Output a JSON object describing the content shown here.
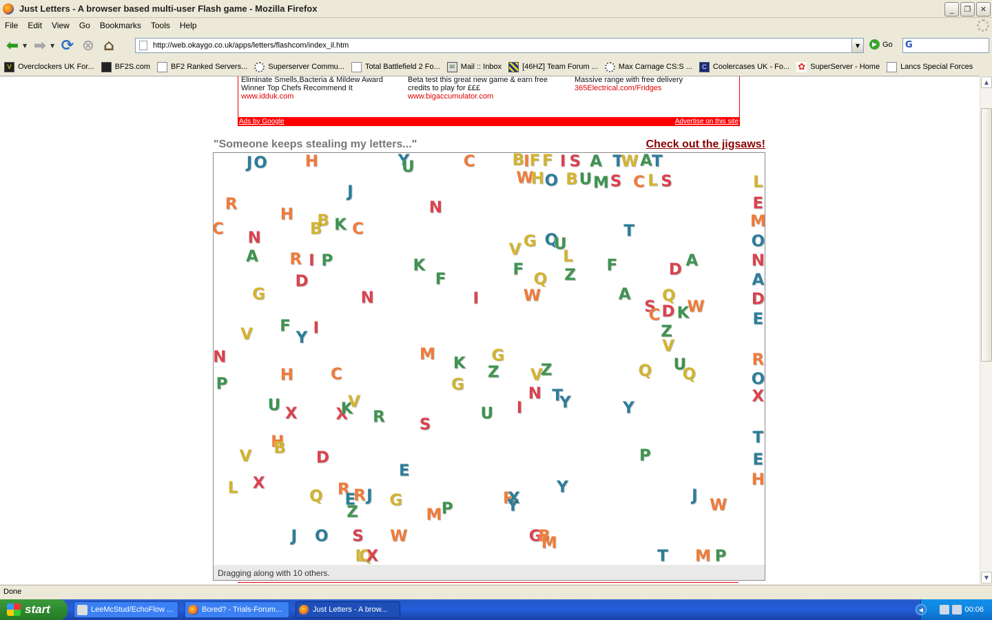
{
  "window": {
    "title": "Just Letters - A browser based multi-user Flash game - Mozilla Firefox",
    "minimize": "_",
    "maximize": "❐",
    "close": "✕"
  },
  "menu": [
    "File",
    "Edit",
    "View",
    "Go",
    "Bookmarks",
    "Tools",
    "Help"
  ],
  "nav": {
    "url": "http://web.okaygo.co.uk/apps/letters/flashcom/index_il.htm",
    "go_label": "Go"
  },
  "bookmarks": [
    {
      "label": "Overclockers UK For...",
      "icon": "oc-icon"
    },
    {
      "label": "BF2S.com",
      "icon": "bf2s-icon"
    },
    {
      "label": "BF2 Ranked Servers...",
      "icon": "bf2-icon"
    },
    {
      "label": "Superserver Commu...",
      "icon": "gear-icon"
    },
    {
      "label": "Total Battlefield 2 Fo...",
      "icon": "tbf-icon"
    },
    {
      "label": "Mail :: Inbox",
      "icon": "mail-icon"
    },
    {
      "label": "[46HZ] Team Forum ...",
      "icon": "checker-icon"
    },
    {
      "label": "Max Carnage CS:S ...",
      "icon": "gear-icon"
    },
    {
      "label": "Coolercases UK - Fo...",
      "icon": "cc-icon"
    },
    {
      "label": "SuperServer - Home",
      "icon": "flower-icon"
    },
    {
      "label": "Lancs Special Forces",
      "icon": "page-icon"
    }
  ],
  "ads": [
    {
      "line1": "Eliminate Smells,Bacteria & Mildew Award",
      "line2": "Winner Top Chefs Recommend It",
      "url": "www.idduk.com"
    },
    {
      "line1": "Beta test this great new game & earn free",
      "line2": "credits to play for £££",
      "url": "www.bigaccumulator.com"
    },
    {
      "line1": "Massive range with free delivery",
      "line2": "",
      "url": "365Electrical.com/Fridges"
    }
  ],
  "ad_footer": {
    "left": "Ads by Google",
    "right": "Advertise on this site"
  },
  "tagline": "\"Someone keeps stealing my letters...\"",
  "jigsaw_link": "Check out the jigsaws!",
  "game": {
    "status": "Dragging along with 10 others.",
    "colors": {
      "red": "#d9434f",
      "green": "#3f9350",
      "blue": "#2c7d9a",
      "yellow": "#d3b431",
      "orange": "#ef7b3a"
    },
    "letters": [
      {
        "ch": "J",
        "c": "blue",
        "x": 6.5,
        "y": 2.5
      },
      {
        "ch": "O",
        "c": "blue",
        "x": 8.5,
        "y": 2.5
      },
      {
        "ch": "H",
        "c": "orange",
        "x": 17.8,
        "y": 2.2
      },
      {
        "ch": "Y",
        "c": "blue",
        "x": 34.5,
        "y": 2
      },
      {
        "ch": "U",
        "c": "green",
        "x": 35.3,
        "y": 3.5
      },
      {
        "ch": "C",
        "c": "orange",
        "x": 46.4,
        "y": 2.2
      },
      {
        "ch": "B",
        "c": "yellow",
        "x": 55.3,
        "y": 1.8
      },
      {
        "ch": "I",
        "c": "orange",
        "x": 56.8,
        "y": 2.2
      },
      {
        "ch": "F",
        "c": "yellow",
        "x": 58.3,
        "y": 2
      },
      {
        "ch": "F",
        "c": "yellow",
        "x": 60.6,
        "y": 2
      },
      {
        "ch": "I",
        "c": "red",
        "x": 63.4,
        "y": 2.2
      },
      {
        "ch": "S",
        "c": "red",
        "x": 65.6,
        "y": 2.2
      },
      {
        "ch": "A",
        "c": "green",
        "x": 69.4,
        "y": 2.2
      },
      {
        "ch": "T",
        "c": "blue",
        "x": 73.4,
        "y": 2.2
      },
      {
        "ch": "W",
        "c": "yellow",
        "x": 75.5,
        "y": 2.2
      },
      {
        "ch": "A",
        "c": "green",
        "x": 78.5,
        "y": 2
      },
      {
        "ch": "T",
        "c": "blue",
        "x": 80.5,
        "y": 2.2
      },
      {
        "ch": "W",
        "c": "orange",
        "x": 56.5,
        "y": 6.2
      },
      {
        "ch": "H",
        "c": "yellow",
        "x": 58.8,
        "y": 6.3
      },
      {
        "ch": "O",
        "c": "blue",
        "x": 61.3,
        "y": 6.8
      },
      {
        "ch": "B",
        "c": "yellow",
        "x": 65.0,
        "y": 6.6
      },
      {
        "ch": "U",
        "c": "green",
        "x": 67.5,
        "y": 6.6
      },
      {
        "ch": "M",
        "c": "green",
        "x": 70.3,
        "y": 7.3
      },
      {
        "ch": "S",
        "c": "red",
        "x": 73.0,
        "y": 7.0
      },
      {
        "ch": "C",
        "c": "orange",
        "x": 77.2,
        "y": 7.2
      },
      {
        "ch": "L",
        "c": "yellow",
        "x": 79.7,
        "y": 6.8
      },
      {
        "ch": "S",
        "c": "red",
        "x": 82.2,
        "y": 7.0
      },
      {
        "ch": "L",
        "c": "yellow",
        "x": 98.8,
        "y": 7.2
      },
      {
        "ch": "E",
        "c": "red",
        "x": 98.8,
        "y": 12.3
      },
      {
        "ch": "M",
        "c": "orange",
        "x": 98.8,
        "y": 16.8
      },
      {
        "ch": "O",
        "c": "blue",
        "x": 98.8,
        "y": 21.5
      },
      {
        "ch": "N",
        "c": "red",
        "x": 98.8,
        "y": 26.2
      },
      {
        "ch": "A",
        "c": "blue",
        "x": 98.8,
        "y": 31.0
      },
      {
        "ch": "D",
        "c": "red",
        "x": 98.8,
        "y": 35.7
      },
      {
        "ch": "E",
        "c": "blue",
        "x": 98.8,
        "y": 40.5
      },
      {
        "ch": "R",
        "c": "orange",
        "x": 98.8,
        "y": 50.3
      },
      {
        "ch": "O",
        "c": "blue",
        "x": 98.8,
        "y": 55.0
      },
      {
        "ch": "X",
        "c": "red",
        "x": 98.8,
        "y": 59.2
      },
      {
        "ch": "T",
        "c": "blue",
        "x": 98.8,
        "y": 69.2
      },
      {
        "ch": "E",
        "c": "blue",
        "x": 98.8,
        "y": 74.5
      },
      {
        "ch": "H",
        "c": "orange",
        "x": 98.8,
        "y": 79.5
      },
      {
        "ch": "J",
        "c": "blue",
        "x": 24.8,
        "y": 9.5
      },
      {
        "ch": "R",
        "c": "orange",
        "x": 3.2,
        "y": 12.5
      },
      {
        "ch": "N",
        "c": "red",
        "x": 40.3,
        "y": 13.3
      },
      {
        "ch": "H",
        "c": "orange",
        "x": 13.3,
        "y": 15
      },
      {
        "ch": "B",
        "c": "yellow",
        "x": 19.9,
        "y": 16.5
      },
      {
        "ch": "B",
        "c": "yellow",
        "x": 18.6,
        "y": 18.5
      },
      {
        "ch": "K",
        "c": "green",
        "x": 23.0,
        "y": 17.5
      },
      {
        "ch": "C",
        "c": "orange",
        "x": 26.2,
        "y": 18.6
      },
      {
        "ch": "C",
        "c": "orange",
        "x": 0.8,
        "y": 18.6
      },
      {
        "ch": "N",
        "c": "red",
        "x": 7.4,
        "y": 20.8
      },
      {
        "ch": "A",
        "c": "green",
        "x": 7.0,
        "y": 25.2
      },
      {
        "ch": "R",
        "c": "orange",
        "x": 14.9,
        "y": 26.0
      },
      {
        "ch": "I",
        "c": "red",
        "x": 17.8,
        "y": 26.3
      },
      {
        "ch": "P",
        "c": "green",
        "x": 20.6,
        "y": 26.3
      },
      {
        "ch": "D",
        "c": "red",
        "x": 16.0,
        "y": 31.3
      },
      {
        "ch": "K",
        "c": "green",
        "x": 37.3,
        "y": 27.5
      },
      {
        "ch": "F",
        "c": "green",
        "x": 41.2,
        "y": 30.8
      },
      {
        "ch": "I",
        "c": "red",
        "x": 47.6,
        "y": 35.5
      },
      {
        "ch": "N",
        "c": "red",
        "x": 27.9,
        "y": 35.3
      },
      {
        "ch": "G",
        "c": "yellow",
        "x": 8.2,
        "y": 34.5
      },
      {
        "ch": "V",
        "c": "yellow",
        "x": 54.7,
        "y": 23.5
      },
      {
        "ch": "G",
        "c": "yellow",
        "x": 57.4,
        "y": 21.5
      },
      {
        "ch": "Q",
        "c": "blue",
        "x": 61.3,
        "y": 21.2
      },
      {
        "ch": "U",
        "c": "green",
        "x": 62.9,
        "y": 22.3
      },
      {
        "ch": "L",
        "c": "yellow",
        "x": 64.3,
        "y": 25.3
      },
      {
        "ch": "F",
        "c": "green",
        "x": 55.3,
        "y": 28.5
      },
      {
        "ch": "Q",
        "c": "yellow",
        "x": 59.3,
        "y": 30.8
      },
      {
        "ch": "W",
        "c": "orange",
        "x": 57.8,
        "y": 34.7
      },
      {
        "ch": "Z",
        "c": "green",
        "x": 64.7,
        "y": 29.8
      },
      {
        "ch": "T",
        "c": "blue",
        "x": 75.4,
        "y": 19.0
      },
      {
        "ch": "F",
        "c": "green",
        "x": 72.3,
        "y": 27.5
      },
      {
        "ch": "A",
        "c": "green",
        "x": 74.6,
        "y": 34.5
      },
      {
        "ch": "D",
        "c": "red",
        "x": 83.8,
        "y": 28.5
      },
      {
        "ch": "A",
        "c": "green",
        "x": 86.8,
        "y": 26.3
      },
      {
        "ch": "Q",
        "c": "yellow",
        "x": 82.6,
        "y": 34.8
      },
      {
        "ch": "S",
        "c": "red",
        "x": 79.2,
        "y": 37.5
      },
      {
        "ch": "C",
        "c": "orange",
        "x": 80.0,
        "y": 39.5
      },
      {
        "ch": "D",
        "c": "red",
        "x": 82.5,
        "y": 38.7
      },
      {
        "ch": "K",
        "c": "green",
        "x": 85.2,
        "y": 38.9
      },
      {
        "ch": "W",
        "c": "orange",
        "x": 87.5,
        "y": 37.5
      },
      {
        "ch": "Z",
        "c": "green",
        "x": 82.2,
        "y": 43.5
      },
      {
        "ch": "V",
        "c": "yellow",
        "x": 82.5,
        "y": 47.0
      },
      {
        "ch": "U",
        "c": "green",
        "x": 84.6,
        "y": 51.5
      },
      {
        "ch": "Q",
        "c": "yellow",
        "x": 86.3,
        "y": 53.8
      },
      {
        "ch": "Q",
        "c": "yellow",
        "x": 78.3,
        "y": 53.0
      },
      {
        "ch": "V",
        "c": "yellow",
        "x": 6.0,
        "y": 44.1
      },
      {
        "ch": "F",
        "c": "green",
        "x": 13.0,
        "y": 42.2
      },
      {
        "ch": "Y",
        "c": "blue",
        "x": 16.0,
        "y": 45.0
      },
      {
        "ch": "I",
        "c": "red",
        "x": 18.6,
        "y": 42.7
      },
      {
        "ch": "N",
        "c": "red",
        "x": 1.1,
        "y": 49.7
      },
      {
        "ch": "P",
        "c": "green",
        "x": 1.5,
        "y": 56.2
      },
      {
        "ch": "H",
        "c": "orange",
        "x": 13.3,
        "y": 54.0
      },
      {
        "ch": "C",
        "c": "orange",
        "x": 22.3,
        "y": 53.8
      },
      {
        "ch": "M",
        "c": "orange",
        "x": 38.8,
        "y": 49.0
      },
      {
        "ch": "K",
        "c": "green",
        "x": 44.6,
        "y": 51.2
      },
      {
        "ch": "G",
        "c": "yellow",
        "x": 51.6,
        "y": 49.3
      },
      {
        "ch": "Z",
        "c": "green",
        "x": 50.8,
        "y": 53.3
      },
      {
        "ch": "G",
        "c": "yellow",
        "x": 44.3,
        "y": 56.3
      },
      {
        "ch": "V",
        "c": "yellow",
        "x": 58.6,
        "y": 54.0
      },
      {
        "ch": "Z",
        "c": "green",
        "x": 60.4,
        "y": 52.8
      },
      {
        "ch": "N",
        "c": "red",
        "x": 58.3,
        "y": 58.5
      },
      {
        "ch": "T",
        "c": "blue",
        "x": 62.4,
        "y": 59.0
      },
      {
        "ch": "Y",
        "c": "blue",
        "x": 63.8,
        "y": 60.7
      },
      {
        "ch": "I",
        "c": "red",
        "x": 55.5,
        "y": 62.0
      },
      {
        "ch": "Y",
        "c": "blue",
        "x": 75.3,
        "y": 62.0
      },
      {
        "ch": "U",
        "c": "green",
        "x": 11.0,
        "y": 61.3
      },
      {
        "ch": "X",
        "c": "red",
        "x": 14.1,
        "y": 63.3
      },
      {
        "ch": "X",
        "c": "red",
        "x": 23.3,
        "y": 63.5
      },
      {
        "ch": "K",
        "c": "green",
        "x": 24.2,
        "y": 62.2
      },
      {
        "ch": "V",
        "c": "yellow",
        "x": 25.5,
        "y": 60.5
      },
      {
        "ch": "R",
        "c": "green",
        "x": 30.0,
        "y": 64.2
      },
      {
        "ch": "S",
        "c": "red",
        "x": 38.4,
        "y": 66.1
      },
      {
        "ch": "U",
        "c": "green",
        "x": 49.6,
        "y": 63.4
      },
      {
        "ch": "H",
        "c": "orange",
        "x": 11.6,
        "y": 70.2
      },
      {
        "ch": "B",
        "c": "yellow",
        "x": 12.0,
        "y": 71.8
      },
      {
        "ch": "V",
        "c": "yellow",
        "x": 5.8,
        "y": 73.8
      },
      {
        "ch": "D",
        "c": "red",
        "x": 19.8,
        "y": 74.1
      },
      {
        "ch": "P",
        "c": "green",
        "x": 78.3,
        "y": 73.5
      },
      {
        "ch": "E",
        "c": "blue",
        "x": 34.6,
        "y": 77.3
      },
      {
        "ch": "L",
        "c": "yellow",
        "x": 3.5,
        "y": 81.5
      },
      {
        "ch": "X",
        "c": "red",
        "x": 8.2,
        "y": 80.2
      },
      {
        "ch": "Q",
        "c": "yellow",
        "x": 18.6,
        "y": 83.5
      },
      {
        "ch": "R",
        "c": "orange",
        "x": 23.6,
        "y": 81.8
      },
      {
        "ch": "R",
        "c": "orange",
        "x": 26.5,
        "y": 83.2
      },
      {
        "ch": "E",
        "c": "blue",
        "x": 24.8,
        "y": 84.2
      },
      {
        "ch": "J",
        "c": "blue",
        "x": 28.3,
        "y": 83.2
      },
      {
        "ch": "Z",
        "c": "green",
        "x": 25.2,
        "y": 87.3
      },
      {
        "ch": "G",
        "c": "yellow",
        "x": 33.1,
        "y": 84.5
      },
      {
        "ch": "M",
        "c": "orange",
        "x": 40.0,
        "y": 88.0
      },
      {
        "ch": "P",
        "c": "green",
        "x": 42.4,
        "y": 86.5
      },
      {
        "ch": "R",
        "c": "orange",
        "x": 53.6,
        "y": 84.0
      },
      {
        "ch": "X",
        "c": "blue",
        "x": 54.5,
        "y": 84.0
      },
      {
        "ch": "Y",
        "c": "blue",
        "x": 54.3,
        "y": 85.8
      },
      {
        "ch": "Y",
        "c": "blue",
        "x": 63.3,
        "y": 81.2
      },
      {
        "ch": "J",
        "c": "blue",
        "x": 87.3,
        "y": 83.3
      },
      {
        "ch": "W",
        "c": "orange",
        "x": 91.6,
        "y": 85.7
      },
      {
        "ch": "J",
        "c": "blue",
        "x": 14.6,
        "y": 93.1
      },
      {
        "ch": "O",
        "c": "blue",
        "x": 19.6,
        "y": 93.1
      },
      {
        "ch": "S",
        "c": "red",
        "x": 26.2,
        "y": 93.1
      },
      {
        "ch": "W",
        "c": "orange",
        "x": 33.6,
        "y": 93.1
      },
      {
        "ch": "G",
        "c": "red",
        "x": 58.4,
        "y": 93.1
      },
      {
        "ch": "B",
        "c": "orange",
        "x": 60.0,
        "y": 93.1
      },
      {
        "ch": "M",
        "c": "orange",
        "x": 60.9,
        "y": 94.8
      },
      {
        "ch": "L",
        "c": "yellow",
        "x": 26.6,
        "y": 98.0
      },
      {
        "ch": "Q",
        "c": "yellow",
        "x": 27.6,
        "y": 98.0
      },
      {
        "ch": "X",
        "c": "red",
        "x": 28.8,
        "y": 98.0
      },
      {
        "ch": "T",
        "c": "blue",
        "x": 81.5,
        "y": 98.0
      },
      {
        "ch": "M",
        "c": "orange",
        "x": 88.8,
        "y": 98.0
      },
      {
        "ch": "P",
        "c": "green",
        "x": 92.0,
        "y": 98.0
      }
    ]
  },
  "statusbar": {
    "text": "Done"
  },
  "taskbar": {
    "start_label": "start",
    "tasks": [
      {
        "label": "LeeMcStud/EchoFlow ...",
        "icon": "chat-icon"
      },
      {
        "label": "Bored? - Trials-Forum...",
        "icon": "firefox-icon"
      },
      {
        "label": "Just Letters - A brow...",
        "icon": "firefox-icon"
      }
    ],
    "clock": "00:06"
  }
}
